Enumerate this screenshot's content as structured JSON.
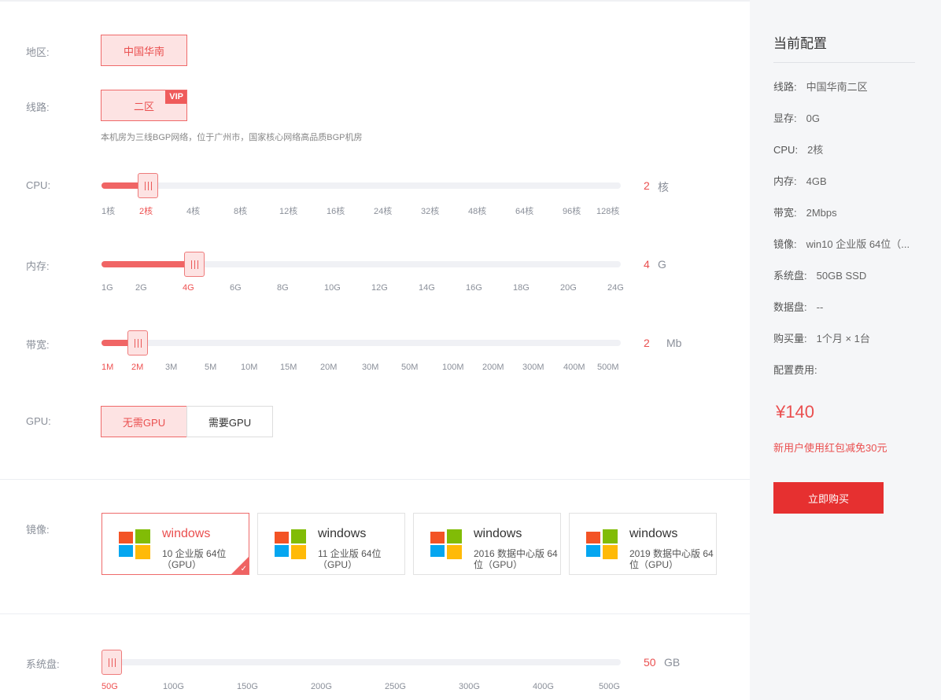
{
  "region": {
    "label": "地区:",
    "option": "中国华南"
  },
  "line": {
    "label": "线路:",
    "option": "二区",
    "badge": "VIP",
    "note": "本机房为三线BGP网络，位于广州市，国家核心网络高品质BGP机房"
  },
  "cpu": {
    "label": "CPU:",
    "value": "2",
    "unit": "核",
    "selected_index": 1,
    "ticks": [
      "1核",
      "2核",
      "4核",
      "8核",
      "12核",
      "16核",
      "24核",
      "32核",
      "48核",
      "64核",
      "96核",
      "128核"
    ]
  },
  "memory": {
    "label": "内存:",
    "value": "4",
    "unit": "G",
    "selected_index": 2,
    "ticks": [
      "1G",
      "2G",
      "4G",
      "6G",
      "8G",
      "10G",
      "12G",
      "14G",
      "16G",
      "18G",
      "20G",
      "24G"
    ]
  },
  "bandwidth": {
    "label": "带宽:",
    "value": "2",
    "unit": "Mb",
    "selected_index": 1,
    "ticks": [
      "1M",
      "2M",
      "3M",
      "5M",
      "10M",
      "15M",
      "20M",
      "30M",
      "50M",
      "100M",
      "200M",
      "300M",
      "400M",
      "500M"
    ]
  },
  "gpu": {
    "label": "GPU:",
    "options": [
      "无需GPU",
      "需要GPU"
    ],
    "selected": 0
  },
  "image": {
    "label": "镜像:",
    "selected": 0,
    "options": [
      {
        "name": "windows",
        "desc": "10 企业版 64位（GPU）"
      },
      {
        "name": "windows",
        "desc": "11 企业版 64位（GPU）"
      },
      {
        "name": "windows",
        "desc": "2016 数据中心版 64位（GPU）"
      },
      {
        "name": "windows",
        "desc": "2019 数据中心版 64位（GPU）"
      }
    ]
  },
  "system_disk": {
    "label": "系统盘:",
    "value": "50",
    "unit": "GB",
    "selected_index": 0,
    "ticks": [
      "50G",
      "100G",
      "150G",
      "200G",
      "250G",
      "300G",
      "400G",
      "500G"
    ]
  },
  "summary": {
    "title": "当前配置",
    "rows": [
      {
        "k": "线路:",
        "v": "中国华南二区"
      },
      {
        "k": "显存:",
        "v": "0G"
      },
      {
        "k": "CPU:",
        "v": "2核"
      },
      {
        "k": "内存:",
        "v": "4GB"
      },
      {
        "k": "带宽:",
        "v": "2Mbps"
      },
      {
        "k": "镜像:",
        "v": "win10 企业版 64位（..."
      },
      {
        "k": "系统盘:",
        "v": "50GB SSD"
      },
      {
        "k": "数据盘:",
        "v": "--"
      },
      {
        "k": "购买量:",
        "v": "1个月 × 1台"
      },
      {
        "k": "配置费用:",
        "v": ""
      }
    ],
    "price": "¥140",
    "promo": "新用户使用红包减免30元",
    "buy_label": "立即购买"
  },
  "colors": {
    "accent": "#ea4f4f",
    "buy": "#e63030",
    "sidebar_bg": "#f5f6f8"
  }
}
